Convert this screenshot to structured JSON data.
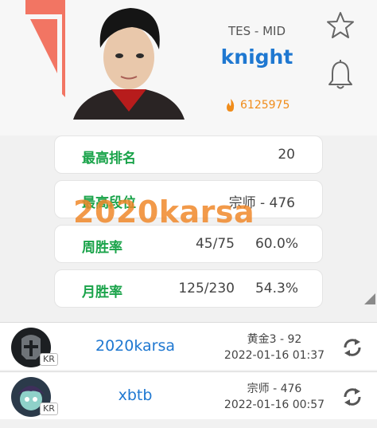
{
  "header": {
    "team_role": "TES - MID",
    "player_name": "knight",
    "popularity": "6125975"
  },
  "icons": {
    "favorite": "star-icon",
    "notify": "bell-icon",
    "help": "?",
    "popularity": "fire-icon",
    "refresh": "refresh-icon"
  },
  "stats": [
    {
      "label": "最高排名",
      "value": "20"
    },
    {
      "label": "最高段位",
      "value": "宗师 - 476"
    },
    {
      "label": "周胜率",
      "value_a": "45/75",
      "value_b": "60.0%"
    },
    {
      "label": "月胜率",
      "value_a": "125/230",
      "value_b": "54.3%"
    }
  ],
  "watermark": "2020karsa",
  "accounts": [
    {
      "region": "KR",
      "name": "2020karsa",
      "rank": "黄金3 - 92",
      "time": "2022-01-16 01:37"
    },
    {
      "region": "KR",
      "name": "xbtb",
      "rank": "宗师 - 476",
      "time": "2022-01-16 00:57"
    }
  ],
  "colors": {
    "accent": "#1f78d1",
    "label_green": "#1aa34a",
    "fire": "#f08c1a",
    "logo_red": "#f27563"
  }
}
